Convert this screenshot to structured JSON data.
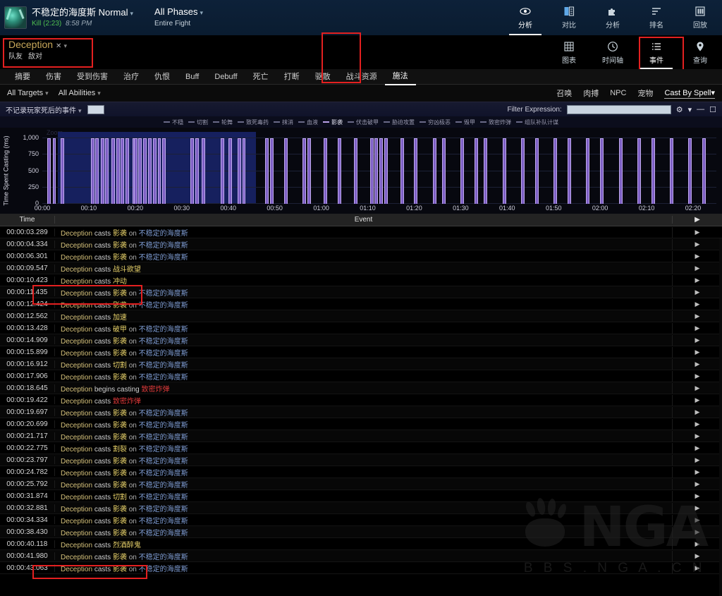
{
  "header": {
    "boss_name": "不稳定的海度斯 Normal",
    "boss_status": "Kill (2:23)",
    "boss_time": "8:58 PM",
    "phase_title": "All Phases",
    "phase_sub": "Entire Fight",
    "nav": [
      {
        "label": "分析",
        "icon": "eye-icon",
        "active": true
      },
      {
        "label": "对比",
        "icon": "compare-icon",
        "active": false
      },
      {
        "label": "分析",
        "icon": "puzzle-icon",
        "active": false
      },
      {
        "label": "排名",
        "icon": "rank-icon",
        "active": false
      },
      {
        "label": "回放",
        "icon": "replay-icon",
        "active": false
      }
    ]
  },
  "player": {
    "name": "Deception",
    "close": "✕",
    "caret": "▾",
    "sub_a": "队友",
    "sub_b": "敌对",
    "nav": [
      {
        "label": "图表",
        "icon": "grid-icon",
        "active": false
      },
      {
        "label": "时间轴",
        "icon": "clock-icon",
        "active": false
      },
      {
        "label": "事件",
        "icon": "list-icon",
        "active": true
      },
      {
        "label": "查询",
        "icon": "pin-icon",
        "active": false
      }
    ]
  },
  "tabs": [
    {
      "label": "摘要",
      "active": false
    },
    {
      "label": "伤害",
      "active": false
    },
    {
      "label": "受到伤害",
      "active": false
    },
    {
      "label": "治疗",
      "active": false
    },
    {
      "label": "仇恨",
      "active": false
    },
    {
      "label": "Buff",
      "active": false
    },
    {
      "label": "Debuff",
      "active": false
    },
    {
      "label": "死亡",
      "active": false
    },
    {
      "label": "打断",
      "active": false
    },
    {
      "label": "驱散",
      "active": false
    },
    {
      "label": "战斗资源",
      "active": false
    },
    {
      "label": "施法",
      "active": true
    }
  ],
  "filters": {
    "targets": "All Targets",
    "abilities": "All Abilities",
    "caret": "▾",
    "tags": [
      "召唤",
      "肉搏",
      "NPC",
      "宠物"
    ],
    "cast_by": "Cast By Spell"
  },
  "chart_toolbar": {
    "dropdown": "不记录玩家死后的事件",
    "caret": "▾",
    "filter_label": "Filter Expression:",
    "filter_value": "",
    "filter_placeholder": "",
    "gear": "⚙",
    "gear_caret": "▾",
    "minimize": "—",
    "maximize": "☐",
    "zoom_label": "Zoom"
  },
  "chart_data": {
    "type": "bar",
    "title": "",
    "xlabel": "",
    "ylabel": "Time Spent Casting (ms)",
    "ylim": [
      0,
      1100
    ],
    "yticks": [
      0,
      250,
      500,
      750,
      1000
    ],
    "ytick_labels": [
      "0",
      "250",
      "500",
      "750",
      "1,000"
    ],
    "xlim": [
      0,
      145
    ],
    "xtick_labels": [
      "00:00",
      "00:10",
      "00:20",
      "00:30",
      "00:40",
      "00:50",
      "01:00",
      "01:10",
      "01:20",
      "01:30",
      "01:40",
      "01:50",
      "02:00",
      "02:10",
      "02:20"
    ],
    "xticks": [
      0,
      10,
      20,
      30,
      40,
      50,
      60,
      70,
      80,
      90,
      100,
      110,
      120,
      130,
      140
    ],
    "grid": true,
    "selection": {
      "from": 3.3,
      "to": 46.0
    },
    "bar_color": "#7d5fc4",
    "bar_edge_color": "#c0a9ee",
    "selection_color": "#16205e",
    "legend_position": "top",
    "legend": [
      {
        "label": "不穏",
        "on": false
      },
      {
        "label": "切割",
        "on": false
      },
      {
        "label": "轮舞",
        "on": false
      },
      {
        "label": "致死毒药",
        "on": false
      },
      {
        "label": "抹消",
        "on": false
      },
      {
        "label": "血液",
        "on": false
      },
      {
        "label": "影袭",
        "on": true
      },
      {
        "label": "伏击破甲",
        "on": false
      },
      {
        "label": "胁迫攻置",
        "on": false
      },
      {
        "label": "穷凶极恶",
        "on": false
      },
      {
        "label": "毁甲",
        "on": false
      },
      {
        "label": "致密炸弹",
        "on": false
      },
      {
        "label": "组队补队计谋",
        "on": false
      }
    ],
    "x": [
      1.0,
      2.2,
      4.0,
      10.5,
      11.4,
      12.6,
      13.5,
      14.9,
      15.9,
      16.9,
      17.9,
      19.4,
      19.7,
      20.7,
      21.7,
      22.8,
      23.8,
      24.8,
      25.8,
      31.9,
      32.9,
      34.3,
      38.4,
      40.1,
      42.0,
      43.0,
      48.0,
      49.0,
      52.0,
      56.0,
      57.0,
      60.5,
      63.5,
      67.0,
      70.5,
      71.5,
      72.5,
      73.5,
      77.0,
      80.0,
      84.0,
      86.0,
      90.0,
      93.0,
      95.0,
      99.0,
      103.0,
      106.0,
      110.0,
      113.0,
      117.0,
      120.0,
      124.0,
      128.0,
      131.0,
      135.0,
      139.0,
      142.0
    ],
    "values": [
      1000,
      1000,
      1000,
      1000,
      1000,
      1000,
      1000,
      1000,
      1000,
      1000,
      1000,
      1000,
      1000,
      1000,
      1000,
      1000,
      1000,
      1000,
      1000,
      1000,
      1000,
      1000,
      1000,
      1000,
      1000,
      1000,
      1000,
      1000,
      1000,
      1000,
      1000,
      1000,
      1000,
      1000,
      1000,
      1000,
      1000,
      1000,
      1000,
      1000,
      1000,
      1000,
      1000,
      1000,
      1000,
      1000,
      1000,
      1000,
      1000,
      1000,
      1000,
      1000,
      1000,
      1000,
      1000,
      1000,
      1000,
      1000
    ]
  },
  "table": {
    "columns": {
      "time": "Time",
      "event": "Event",
      "arrow": "▶"
    },
    "rows": [
      {
        "time": "00:00:03.289",
        "actor": "Deception",
        "verb": "casts",
        "spell": "影袭",
        "spell_red": false,
        "on": "on",
        "target": "不稳定的海度斯",
        "arrow": "▶"
      },
      {
        "time": "00:00:04.334",
        "actor": "Deception",
        "verb": "casts",
        "spell": "影袭",
        "spell_red": false,
        "on": "on",
        "target": "不稳定的海度斯",
        "arrow": "▶"
      },
      {
        "time": "00:00:06.301",
        "actor": "Deception",
        "verb": "casts",
        "spell": "影袭",
        "spell_red": false,
        "on": "on",
        "target": "不稳定的海度斯",
        "arrow": "▶"
      },
      {
        "time": "00:00:09.547",
        "actor": "Deception",
        "verb": "casts",
        "spell": "战斗欲望",
        "spell_red": false,
        "on": "",
        "target": "",
        "arrow": "▶"
      },
      {
        "time": "00:00:10.423",
        "actor": "Deception",
        "verb": "casts",
        "spell": "冲动",
        "spell_red": false,
        "on": "",
        "target": "",
        "arrow": "▶"
      },
      {
        "time": "00:00:11.435",
        "actor": "Deception",
        "verb": "casts",
        "spell": "影袭",
        "spell_red": false,
        "on": "on",
        "target": "不稳定的海度斯",
        "arrow": "▶"
      },
      {
        "time": "00:00:12.424",
        "actor": "Deception",
        "verb": "casts",
        "spell": "影袭",
        "spell_red": false,
        "on": "on",
        "target": "不稳定的海度斯",
        "arrow": "▶"
      },
      {
        "time": "00:00:12.562",
        "actor": "Deception",
        "verb": "casts",
        "spell": "加速",
        "spell_red": false,
        "on": "",
        "target": "",
        "arrow": "▶"
      },
      {
        "time": "00:00:13.428",
        "actor": "Deception",
        "verb": "casts",
        "spell": "破甲",
        "spell_red": false,
        "on": "on",
        "target": "不稳定的海度斯",
        "arrow": "▶"
      },
      {
        "time": "00:00:14.909",
        "actor": "Deception",
        "verb": "casts",
        "spell": "影袭",
        "spell_red": false,
        "on": "on",
        "target": "不稳定的海度斯",
        "arrow": "▶"
      },
      {
        "time": "00:00:15.899",
        "actor": "Deception",
        "verb": "casts",
        "spell": "影袭",
        "spell_red": false,
        "on": "on",
        "target": "不稳定的海度斯",
        "arrow": "▶"
      },
      {
        "time": "00:00:16.912",
        "actor": "Deception",
        "verb": "casts",
        "spell": "切割",
        "spell_red": false,
        "on": "on",
        "target": "不稳定的海度斯",
        "arrow": "▶"
      },
      {
        "time": "00:00:17.906",
        "actor": "Deception",
        "verb": "casts",
        "spell": "影袭",
        "spell_red": false,
        "on": "on",
        "target": "不稳定的海度斯",
        "arrow": "▶"
      },
      {
        "time": "00:00:18.645",
        "actor": "Deception",
        "verb": "begins casting",
        "spell": "致密炸弹",
        "spell_red": true,
        "on": "",
        "target": "",
        "arrow": "▶"
      },
      {
        "time": "00:00:19.422",
        "actor": "Deception",
        "verb": "casts",
        "spell": "致密炸弹",
        "spell_red": true,
        "on": "",
        "target": "",
        "arrow": "▶"
      },
      {
        "time": "00:00:19.697",
        "actor": "Deception",
        "verb": "casts",
        "spell": "影袭",
        "spell_red": false,
        "on": "on",
        "target": "不稳定的海度斯",
        "arrow": "▶"
      },
      {
        "time": "00:00:20.699",
        "actor": "Deception",
        "verb": "casts",
        "spell": "影袭",
        "spell_red": false,
        "on": "on",
        "target": "不稳定的海度斯",
        "arrow": "▶"
      },
      {
        "time": "00:00:21.717",
        "actor": "Deception",
        "verb": "casts",
        "spell": "影袭",
        "spell_red": false,
        "on": "on",
        "target": "不稳定的海度斯",
        "arrow": "▶"
      },
      {
        "time": "00:00:22.775",
        "actor": "Deception",
        "verb": "casts",
        "spell": "割裂",
        "spell_red": false,
        "on": "on",
        "target": "不稳定的海度斯",
        "arrow": "▶"
      },
      {
        "time": "00:00:23.797",
        "actor": "Deception",
        "verb": "casts",
        "spell": "影袭",
        "spell_red": false,
        "on": "on",
        "target": "不稳定的海度斯",
        "arrow": "▶"
      },
      {
        "time": "00:00:24.782",
        "actor": "Deception",
        "verb": "casts",
        "spell": "影袭",
        "spell_red": false,
        "on": "on",
        "target": "不稳定的海度斯",
        "arrow": "▶"
      },
      {
        "time": "00:00:25.792",
        "actor": "Deception",
        "verb": "casts",
        "spell": "影袭",
        "spell_red": false,
        "on": "on",
        "target": "不稳定的海度斯",
        "arrow": "▶"
      },
      {
        "time": "00:00:31.874",
        "actor": "Deception",
        "verb": "casts",
        "spell": "切割",
        "spell_red": false,
        "on": "on",
        "target": "不稳定的海度斯",
        "arrow": "▶"
      },
      {
        "time": "00:00:32.881",
        "actor": "Deception",
        "verb": "casts",
        "spell": "影袭",
        "spell_red": false,
        "on": "on",
        "target": "不稳定的海度斯",
        "arrow": "▶"
      },
      {
        "time": "00:00:34.334",
        "actor": "Deception",
        "verb": "casts",
        "spell": "影袭",
        "spell_red": false,
        "on": "on",
        "target": "不稳定的海度斯",
        "arrow": "▶"
      },
      {
        "time": "00:00:38.430",
        "actor": "Deception",
        "verb": "casts",
        "spell": "影袭",
        "spell_red": false,
        "on": "on",
        "target": "不稳定的海度斯",
        "arrow": "▶"
      },
      {
        "time": "00:00:40.118",
        "actor": "Deception",
        "verb": "casts",
        "spell": "烈酒醉鬼",
        "spell_red": false,
        "on": "",
        "target": "",
        "arrow": "▶"
      },
      {
        "time": "00:00:41.980",
        "actor": "Deception",
        "verb": "casts",
        "spell": "影袭",
        "spell_red": false,
        "on": "on",
        "target": "不稳定的海度斯",
        "arrow": "▶"
      },
      {
        "time": "00:00:43.063",
        "actor": "Deception",
        "verb": "casts",
        "spell": "影袭",
        "spell_red": false,
        "on": "on",
        "target": "不稳定的海度斯",
        "arrow": "▶"
      }
    ]
  },
  "watermark": {
    "text": "NGA",
    "sub": "B B S . N G A . C N"
  }
}
